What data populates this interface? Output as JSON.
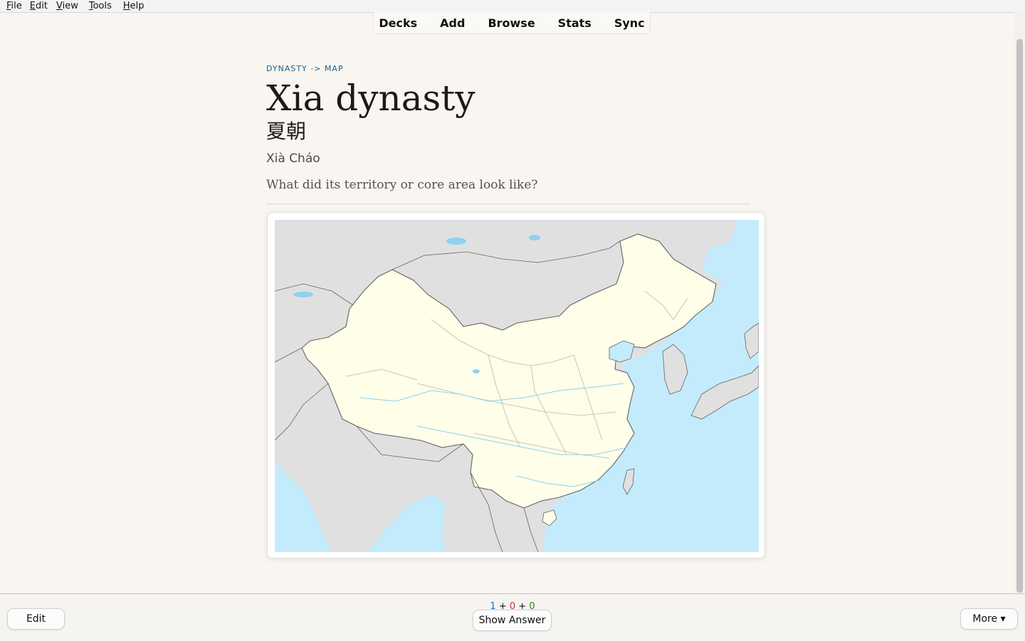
{
  "menu": [
    "File",
    "Edit",
    "View",
    "Tools",
    "Help"
  ],
  "nav": [
    "Decks",
    "Add",
    "Browse",
    "Stats",
    "Sync"
  ],
  "card": {
    "breadcrumb": "DYNASTY -> MAP",
    "title": "Xia dynasty",
    "hanzi": "夏朝",
    "pinyin": "Xià Cháo",
    "question": "What did its territory or core area look like?"
  },
  "counts": {
    "new": "1",
    "learning": "0",
    "review": "0",
    "plus": "+"
  },
  "buttons": {
    "edit": "Edit",
    "show_answer": "Show Answer",
    "more": "More ▾"
  },
  "colors": {
    "ocean": "#c4ebfc",
    "land": "#e0e0e0",
    "china": "#fefee9",
    "border": "#646464",
    "river": "#8fd1f0"
  }
}
